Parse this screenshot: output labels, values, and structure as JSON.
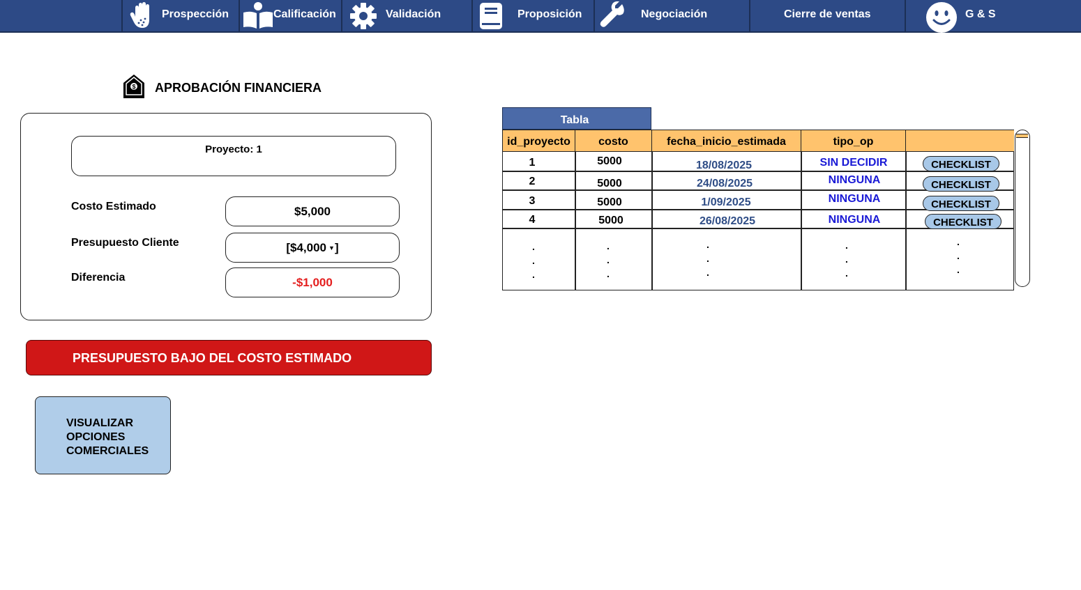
{
  "nav": {
    "prospeccion": "Prospección",
    "calificacion": "Calificación",
    "validacion": "Validación",
    "proposicion": "Proposición",
    "negociacion": "Negociación",
    "cierre": "Cierre de ventas",
    "user": "G & S"
  },
  "section": {
    "title": "APROBACIÓN FINANCIERA"
  },
  "form": {
    "project": "Proyecto: 1",
    "costo_label": "Costo Estimado",
    "costo_value": "$5,000",
    "presupuesto_label": "Presupuesto Cliente",
    "presupuesto_value": "[$4,000",
    "presupuesto_close": "]",
    "diferencia_label": "Diferencia",
    "diferencia_value": "-$1,000"
  },
  "alert": {
    "text": "PRESUPUESTO BAJO DEL COSTO ESTIMADO"
  },
  "actions": {
    "visualizar": "VISUALIZAR\nOPCIONES\nCOMERCIALES"
  },
  "table": {
    "caption": "Tabla",
    "headers": [
      "id_proyecto",
      "costo",
      "fecha_inicio_estimada",
      "tipo_op",
      ""
    ],
    "rows": [
      {
        "id": "1",
        "costo": "5000",
        "fecha": "18/08/2025",
        "tipo": "SIN DECIDIR",
        "action": "CHECKLIST"
      },
      {
        "id": "2",
        "costo": "5000",
        "fecha": "24/08/2025",
        "tipo": "NINGUNA",
        "action": "CHECKLIST"
      },
      {
        "id": "3",
        "costo": "5000",
        "fecha": "1/09/2025",
        "tipo": "NINGUNA",
        "action": "CHECKLIST"
      },
      {
        "id": "4",
        "costo": "5000",
        "fecha": "26/08/2025",
        "tipo": "NINGUNA",
        "action": "CHECKLIST"
      }
    ],
    "ellipsis": ".\n.\n."
  },
  "colors": {
    "nav_bg": "#2d4a86",
    "header_bg": "#ffc36d",
    "alert_bg": "#d01717",
    "button_bg": "#b0cde9",
    "negative": "#e41e1e",
    "tipo_text": "#1a1ad6"
  },
  "icons": [
    "hand-icon",
    "book-reader-icon",
    "gear-icon",
    "document-icon",
    "wrench-icon",
    "smiley-icon",
    "money-tag-icon"
  ]
}
